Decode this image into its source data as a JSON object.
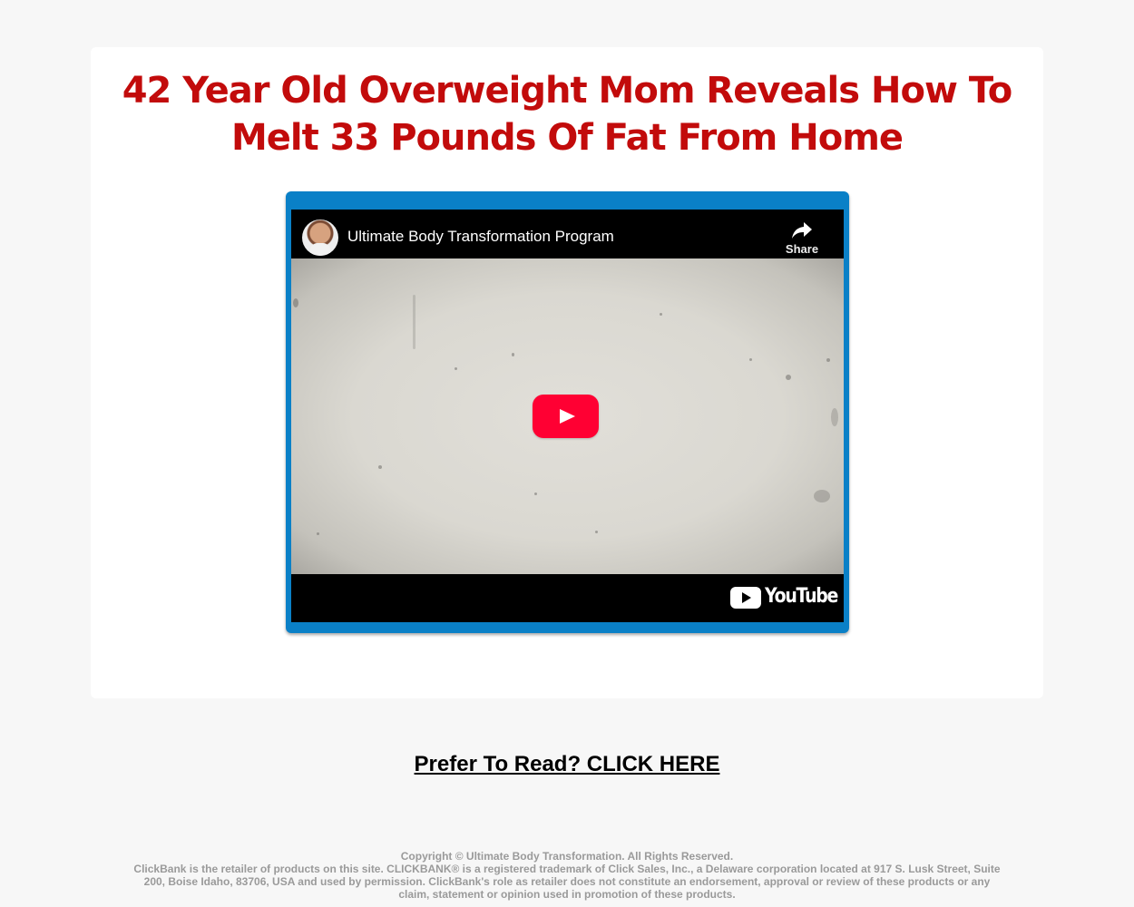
{
  "headline": {
    "line1": "42 Year Old Overweight Mom Reveals How To",
    "line2": "Melt 33 Pounds Of Fat From Home"
  },
  "video": {
    "title": "Ultimate Body Transformation Program",
    "share_label": "Share",
    "brand": "YouTube",
    "play_button_color": "#ff0033",
    "frame_color": "#0a80c7"
  },
  "cta": {
    "label": "Prefer To Read? CLICK HERE"
  },
  "footer": {
    "copyright": "Copyright © Ultimate Body Transformation. All Rights Reserved.",
    "disclaimer": "ClickBank is the retailer of products on this site. CLICKBANK® is a registered trademark of Click Sales, Inc., a Delaware corporation located at 917 S. Lusk Street, Suite 200, Boise Idaho, 83706, USA and used by permission. ClickBank's role as retailer does not constitute an endorsement, approval or review of these products or any claim, statement or opinion used in promotion of these products."
  },
  "colors": {
    "headline": "#c20b0b",
    "page_background": "#f7f7f7",
    "footer_text": "#9a9a9a"
  }
}
